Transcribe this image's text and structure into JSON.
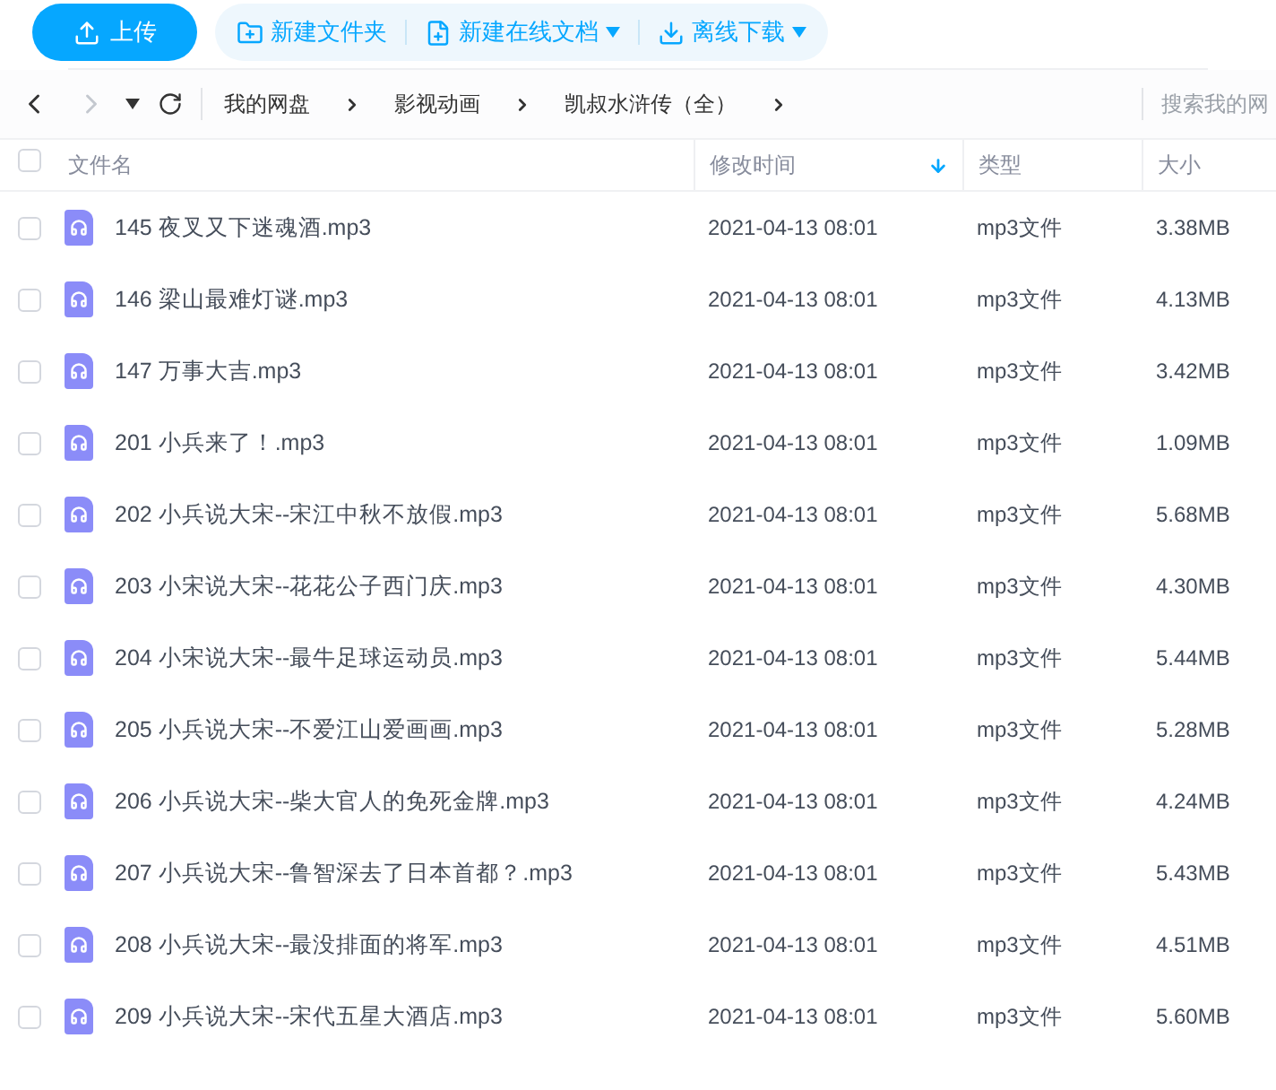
{
  "toolbar": {
    "upload": "上传",
    "actions": [
      {
        "kind": "folder",
        "label": "新建文件夹",
        "has_menu": false
      },
      {
        "kind": "doc",
        "label": "新建在线文档",
        "has_menu": true
      },
      {
        "kind": "download",
        "label": "离线下载",
        "has_menu": true
      }
    ]
  },
  "nav": {
    "back_disabled": false,
    "forward_disabled": true,
    "breadcrumb": [
      "我的网盘",
      "影视动画",
      "凯叔水浒传（全）"
    ],
    "search": {
      "placeholder": "搜索我的网"
    }
  },
  "table": {
    "all_checked": false,
    "columns": [
      {
        "label": "文件名",
        "sorted": false
      },
      {
        "label": "修改时间",
        "sorted": true
      },
      {
        "label": "类型",
        "sorted": false
      },
      {
        "label": "大小",
        "sorted": false
      }
    ],
    "rows": [
      {
        "name": "145 夜叉又下迷魂酒.mp3",
        "time": "2021-04-13 08:01",
        "type": "mp3文件",
        "size": "3.38MB",
        "checked": false
      },
      {
        "name": "146 梁山最难灯谜.mp3",
        "time": "2021-04-13 08:01",
        "type": "mp3文件",
        "size": "4.13MB",
        "checked": false
      },
      {
        "name": "147 万事大吉.mp3",
        "time": "2021-04-13 08:01",
        "type": "mp3文件",
        "size": "3.42MB",
        "checked": false
      },
      {
        "name": "201 小兵来了！.mp3",
        "time": "2021-04-13 08:01",
        "type": "mp3文件",
        "size": "1.09MB",
        "checked": false
      },
      {
        "name": "202 小兵说大宋--宋江中秋不放假.mp3",
        "time": "2021-04-13 08:01",
        "type": "mp3文件",
        "size": "5.68MB",
        "checked": false
      },
      {
        "name": "203 小宋说大宋--花花公子西门庆.mp3",
        "time": "2021-04-13 08:01",
        "type": "mp3文件",
        "size": "4.30MB",
        "checked": false
      },
      {
        "name": "204 小宋说大宋--最牛足球运动员.mp3",
        "time": "2021-04-13 08:01",
        "type": "mp3文件",
        "size": "5.44MB",
        "checked": false
      },
      {
        "name": "205 小兵说大宋--不爱江山爱画画.mp3",
        "time": "2021-04-13 08:01",
        "type": "mp3文件",
        "size": "5.28MB",
        "checked": false
      },
      {
        "name": "206 小兵说大宋--柴大官人的免死金牌.mp3",
        "time": "2021-04-13 08:01",
        "type": "mp3文件",
        "size": "4.24MB",
        "checked": false
      },
      {
        "name": "207 小兵说大宋--鲁智深去了日本首都？.mp3",
        "time": "2021-04-13 08:01",
        "type": "mp3文件",
        "size": "5.43MB",
        "checked": false
      },
      {
        "name": "208 小兵说大宋--最没排面的将军.mp3",
        "time": "2021-04-13 08:01",
        "type": "mp3文件",
        "size": "4.51MB",
        "checked": false
      },
      {
        "name": "209 小兵说大宋--宋代五星大酒店.mp3",
        "time": "2021-04-13 08:01",
        "type": "mp3文件",
        "size": "5.60MB",
        "checked": false
      }
    ]
  }
}
